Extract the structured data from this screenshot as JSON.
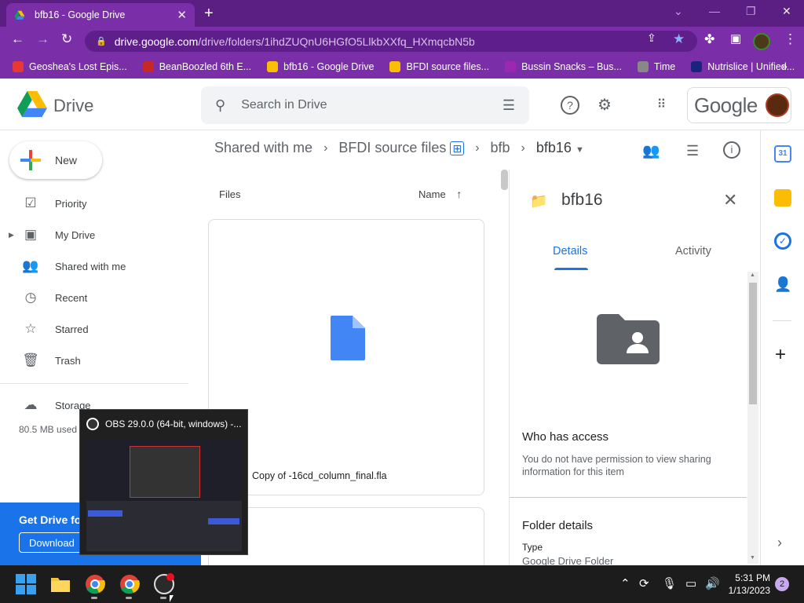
{
  "browser": {
    "tab_title": "bfb16 - Google Drive",
    "new_tab": "+",
    "url_host": "drive.google.com",
    "url_path": "/drive/folders/1ihdZUQnU6HGfO5LlkbXXfq_HXmqcbN5b",
    "bookmarks": [
      {
        "label": "Geoshea's Lost Epis...",
        "color": "#e53935"
      },
      {
        "label": "BeanBoozled 6th E...",
        "color": "#c62828"
      },
      {
        "label": "bfb16 - Google Drive",
        "color": "#fbbc04"
      },
      {
        "label": "BFDI source files...",
        "color": "#fbbc04"
      },
      {
        "label": "Bussin Snacks – Bus...",
        "color": "#9c27b0"
      },
      {
        "label": "Time",
        "color": "#888888"
      },
      {
        "label": "Nutrislice | Unified...",
        "color": "#1a237e"
      }
    ],
    "more_bookmarks": "»"
  },
  "drive": {
    "logo_text": "Drive",
    "search_placeholder": "Search in Drive",
    "account_word": "Google",
    "new_label": "New",
    "nav": [
      {
        "label": "Priority",
        "icon": "checkbox-icon"
      },
      {
        "label": "My Drive",
        "icon": "my-drive-icon"
      },
      {
        "label": "Shared with me",
        "icon": "people-icon"
      },
      {
        "label": "Recent",
        "icon": "clock-icon"
      },
      {
        "label": "Starred",
        "icon": "star-icon"
      },
      {
        "label": "Trash",
        "icon": "trash-icon"
      }
    ],
    "storage_label": "Storage",
    "storage_used": "80.5 MB used",
    "promo_title": "Get Drive fo",
    "promo_button": "Download",
    "breadcrumb": [
      "Shared with me",
      "BFDI source files",
      "bfb",
      "bfb16"
    ],
    "files_label": "Files",
    "sort_label": "Name",
    "file_name": "Copy of -16cd_column_final.fla"
  },
  "details": {
    "title": "bfb16",
    "tab_details": "Details",
    "tab_activity": "Activity",
    "who_title": "Who has access",
    "who_text": "You do not have permission to view sharing information for this item",
    "folder_details": "Folder details",
    "type_label": "Type",
    "type_value": "Google Drive Folder"
  },
  "obs_popup": {
    "title": "OBS 29.0.0 (64-bit, windows) -..."
  },
  "taskbar": {
    "time": "5:31 PM",
    "date": "1/13/2023",
    "notification_count": "2"
  },
  "colors": {
    "chrome_purple": "#7a2fa8",
    "drive_blue": "#1a73e8"
  }
}
